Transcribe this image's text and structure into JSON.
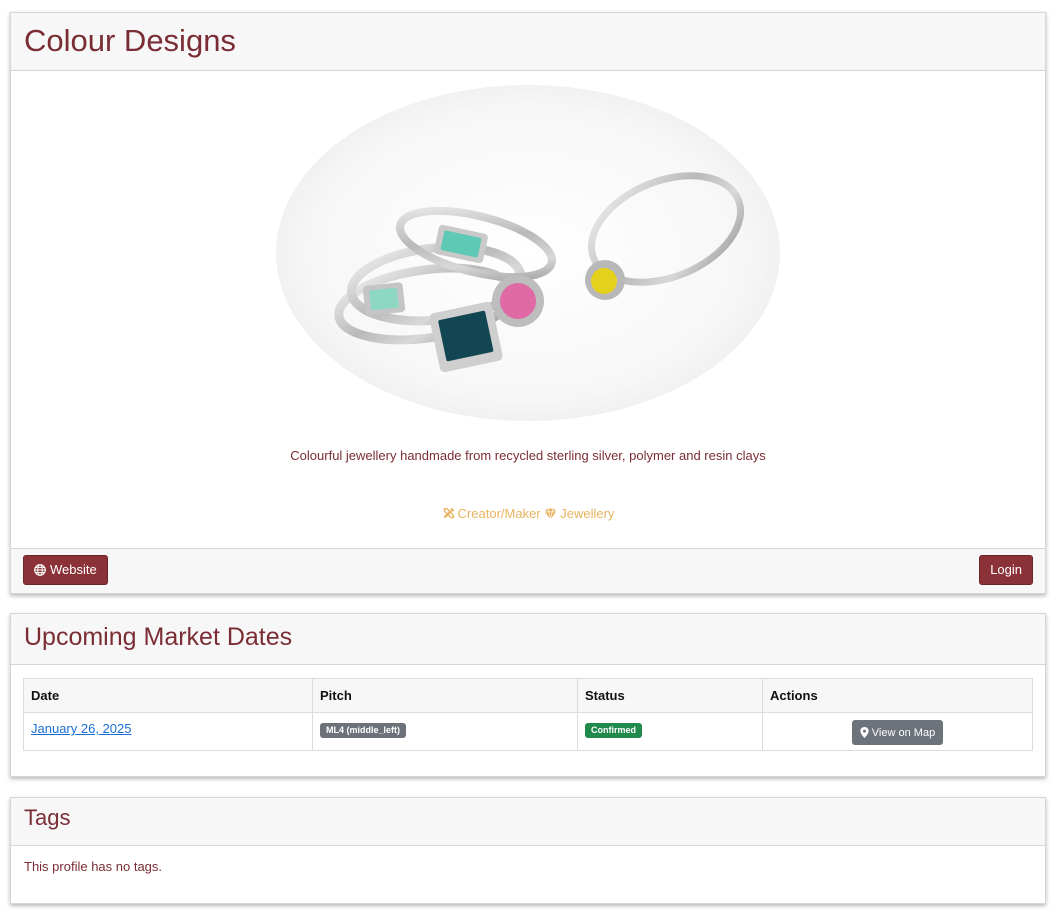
{
  "profile": {
    "title": "Colour Designs",
    "description": "Colourful jewellery handmade from recycled sterling silver, polymer and resin clays",
    "categories": [
      {
        "label": "Creator/Maker",
        "icon": "tools-icon"
      },
      {
        "label": "Jewellery",
        "icon": "gem-icon"
      }
    ],
    "website_label": "Website",
    "login_label": "Login"
  },
  "dates": {
    "title": "Upcoming Market Dates",
    "headers": {
      "date": "Date",
      "pitch": "Pitch",
      "status": "Status",
      "actions": "Actions"
    },
    "rows": [
      {
        "date": "January 26, 2025",
        "pitch": "ML4 (middle_left)",
        "status": "Confirmed",
        "action": "View on Map"
      }
    ]
  },
  "tags": {
    "title": "Tags",
    "empty_message": "This profile has no tags."
  },
  "colors": {
    "brand": "#8a3238",
    "heading": "#7b2d35",
    "category": "#e8b35e",
    "confirmed": "#1f8a4c",
    "pitch_badge": "#6d727a",
    "link": "#1a6fd6"
  }
}
